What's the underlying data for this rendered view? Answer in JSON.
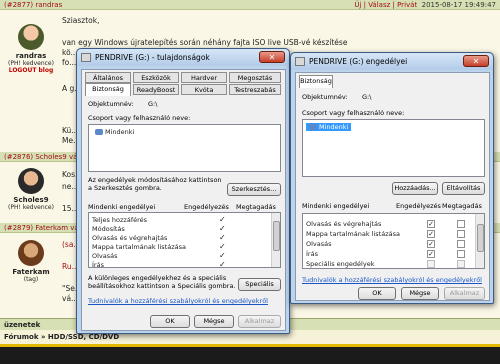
{
  "forum": {
    "post1": {
      "id": "(#2877) randras",
      "date": "2015-08-17 19:49:47",
      "actions": "Új | Válasz | Privát"
    },
    "post1_user": {
      "name": "randras",
      "sub": "(PH! kedvence)",
      "badge": "LOGOUT blog"
    },
    "post1_text": [
      "Sziasztok,",
      "van egy Windows újratelepítés során néhány fajta ISO live USB-vé készítése",
      "kö...",
      "fo...",
      "A g...",
      "Kü...",
      "Me..."
    ],
    "post2": {
      "id": "(#2876) Scholes9 válasza"
    },
    "post2_user": {
      "name": "Scholes9",
      "sub": "(PH! kedvence)"
    },
    "post2_text": [
      "Kos...",
      "ne...",
      "15..."
    ],
    "post3": {
      "id": "(#2879) Faterkam válasza"
    },
    "post3_user": {
      "name": "Faterkam",
      "sub": "(tag)"
    },
    "post3_text": [
      "(sa...",
      "Ru...",
      "\"Se...",
      "vá..."
    ],
    "status_text": "üzenetek",
    "breadcrumb": "Fórumok » HDD/SSD, CD/DVD"
  },
  "props_window": {
    "title": "PENDRIVE (G:) - tulajdonságok",
    "tabs_row1": [
      "Általános",
      "Eszközök",
      "Hardver",
      "Megosztás"
    ],
    "tabs_row2": [
      "Biztonság",
      "ReadyBoost",
      "Kvóta",
      "Testreszabás"
    ],
    "object_label": "Objektumnév:",
    "object_value": "G:\\",
    "group_label": "Csoport vagy felhasználó neve:",
    "group_item": "Mindenki",
    "change_text": [
      "Az engedélyek módosításához kattintson",
      "a Szerkesztés gombra."
    ],
    "edit_button": "Szerkesztés...",
    "perm_header": "Mindenki engedélyei",
    "allow_header": "Engedélyezés",
    "deny_header": "Megtagadás",
    "permissions": [
      "Teljes hozzáférés",
      "Módosítás",
      "Olvasás és végrehajtás",
      "Mappa tartalmának listázása",
      "Olvasás",
      "Írás"
    ],
    "special_text": [
      "A különleges engedélyekhez és a speciális",
      "beállításokhoz kattintson a Speciális gombra."
    ],
    "special_button": "Speciális",
    "help_link": "Tudnivalók a hozzáférési szabályokról és engedélyekről",
    "ok": "OK",
    "cancel": "Mégse",
    "apply": "Alkalmaz"
  },
  "perm_window": {
    "title": "PENDRIVE (G:) engedélyei",
    "tab": "Biztonság",
    "object_label": "Objektumnév:",
    "object_value": "G:\\",
    "group_label": "Csoport vagy felhasználó neve:",
    "group_item": "Mindenki",
    "add_button": "Hozzáadás...",
    "remove_button": "Eltávolítás",
    "perm_header": "Mindenki engedélyei",
    "allow_header": "Engedélyezés",
    "deny_header": "Megtagadás",
    "permissions": [
      "Olvasás és végrehajtás",
      "Mappa tartalmának listázása",
      "Olvasás",
      "Írás",
      "Speciális engedélyek"
    ],
    "help_link": "Tudnivalók a hozzáférési szabályokról és engedélyekről",
    "ok": "OK",
    "cancel": "Mégse",
    "apply": "Alkalmaz"
  }
}
